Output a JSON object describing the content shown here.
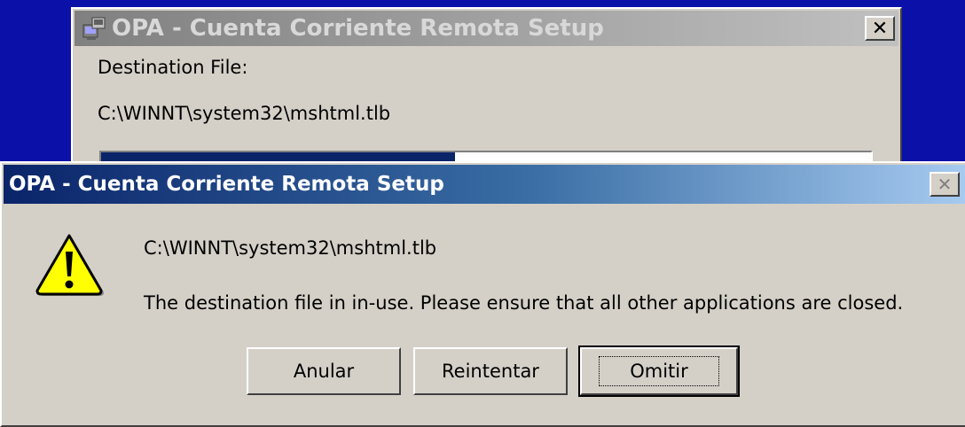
{
  "background_window": {
    "title": "OPA - Cuenta Corriente Remota Setup",
    "close_label": "✕",
    "destination_label": "Destination File:",
    "destination_path": "C:\\WINNT\\system32\\mshtml.tlb",
    "progress": 0.46
  },
  "dialog": {
    "title": "OPA - Cuenta Corriente Remota Setup",
    "close_label": "✕",
    "icon": "warning-icon",
    "path": "C:\\WINNT\\system32\\mshtml.tlb",
    "message": "The destination file in in-use.  Please ensure that all other applications are closed.",
    "buttons": {
      "abort": "Anular",
      "retry": "Reintentar",
      "ignore": "Omitir"
    }
  },
  "colors": {
    "desktop": "#0a10a8",
    "title_active_start": "#0a246a",
    "title_active_end": "#a6caf0",
    "warning_fill": "#ffff00"
  }
}
